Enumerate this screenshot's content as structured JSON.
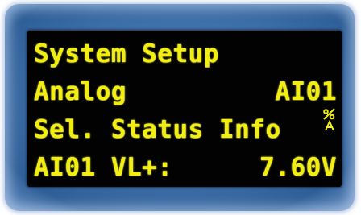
{
  "display": {
    "title": "System Setup",
    "title_icon": "percent-a-icon",
    "row2": {
      "label": "Analog",
      "value": "AI01"
    },
    "row3": {
      "text": "Sel. Status Info"
    },
    "row4": {
      "label": "AI01 VL+:",
      "value": "7.60V"
    }
  },
  "colors": {
    "text": "#f2ef10",
    "screen": "#020202",
    "bezel": "#3d6da6"
  }
}
